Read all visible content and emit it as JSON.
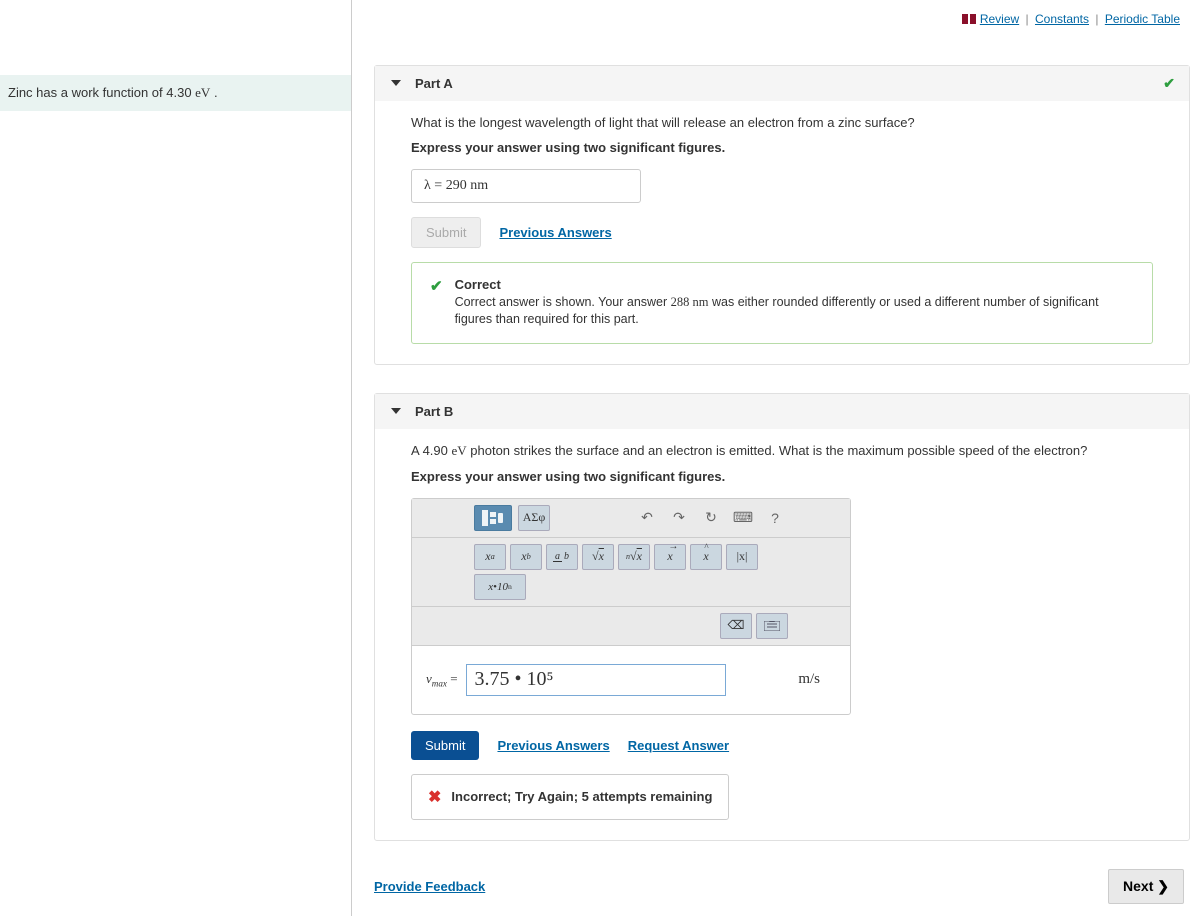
{
  "sidebar": {
    "problem_text_pre": "Zinc has a work function of 4.30 ",
    "problem_unit": "eV",
    "problem_text_post": " ."
  },
  "top_nav": {
    "review": "Review",
    "constants": "Constants",
    "periodic": "Periodic Table"
  },
  "partA": {
    "title": "Part A",
    "question": "What is the longest wavelength of light that will release an electron from a zinc surface?",
    "instruction": "Express your answer using two significant figures.",
    "answer_symbol": "λ = ",
    "answer_value": "290",
    "answer_unit": " nm",
    "submit": "Submit",
    "prev_answers": "Previous Answers",
    "feedback_title": "Correct",
    "feedback_text_pre": "Correct answer is shown. Your answer ",
    "feedback_value": "288 nm",
    "feedback_text_post": " was either rounded differently or used a different number of significant figures than required for this part."
  },
  "partB": {
    "title": "Part B",
    "question_pre": "A 4.90 ",
    "question_unit": "eV",
    "question_post": " photon strikes the surface and an electron is emitted. What is the maximum possible speed of the electron?",
    "instruction": "Express your answer using two significant figures.",
    "toolbar": {
      "greek": "ΑΣφ",
      "sup": "xᵃ",
      "sub": "x_b",
      "frac": "a/b",
      "sqrt": "√x",
      "nroot": "ⁿ√x",
      "vec": "x⃗",
      "hat": "x̂",
      "abs": "|x|",
      "sci": "x•10ⁿ"
    },
    "label": "v",
    "label_sub": "max",
    "equals": " = ",
    "input_value": "3.75 • 10⁵",
    "unit": "m/s",
    "submit": "Submit",
    "prev_answers": "Previous Answers",
    "request_answer": "Request Answer",
    "incorrect": "Incorrect; Try Again; 5 attempts remaining"
  },
  "footer": {
    "provide_feedback": "Provide Feedback",
    "next": "Next ❯"
  }
}
